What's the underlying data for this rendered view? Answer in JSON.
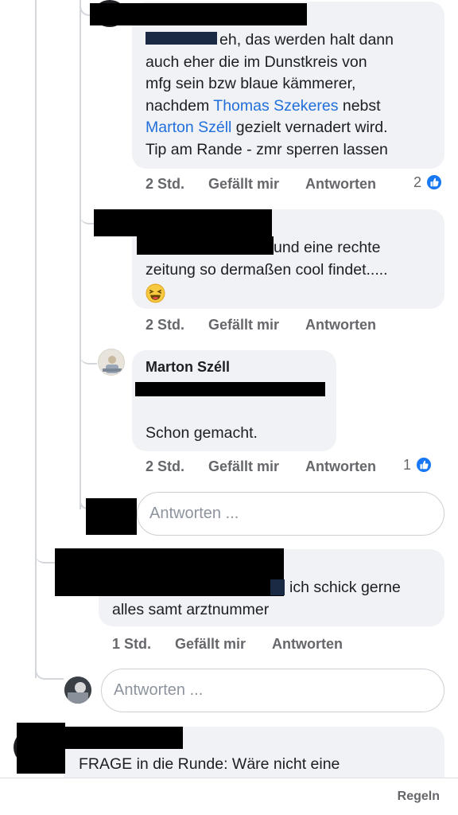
{
  "comments": [
    {
      "lines": [
        {
          "parts": [
            {
              "text": "eh, das werden halt dann",
              "link": false
            }
          ]
        },
        {
          "parts": [
            {
              "text": "auch eher die im Dunstkreis von",
              "link": false
            }
          ]
        },
        {
          "parts": [
            {
              "text": "mfg sein bzw blaue kämmerer,",
              "link": false
            }
          ]
        },
        {
          "parts": [
            {
              "text": "nachdem ",
              "link": false
            },
            {
              "text": "Thomas Szekeres",
              "link": true
            },
            {
              "text": " nebst",
              "link": false
            }
          ]
        },
        {
          "parts": [
            {
              "text": "Marton Széll",
              "link": true
            },
            {
              "text": " gezielt vernadert wird.",
              "link": false
            }
          ]
        },
        {
          "parts": [
            {
              "text": "Tip am Rande - zmr sperren lassen",
              "link": false
            }
          ]
        }
      ],
      "time": "2 Std.",
      "like_label": "Gefällt mir",
      "reply_label": "Antworten",
      "reaction_count": "2"
    },
    {
      "lines": [
        {
          "parts": [
            {
              "text": "und eine rechte",
              "link": false
            }
          ]
        },
        {
          "parts": [
            {
              "text": "zeitung so dermaßen cool findet.....",
              "link": false
            }
          ]
        }
      ],
      "emoji": "laughing-emoji",
      "time": "2 Std.",
      "like_label": "Gefällt mir",
      "reply_label": "Antworten"
    },
    {
      "author": "Marton Széll",
      "text": "Schon gemacht.",
      "time": "2 Std.",
      "like_label": "Gefällt mir",
      "reply_label": "Antworten",
      "reaction_count": "1"
    },
    {
      "lines": [
        {
          "parts": [
            {
              "text": "ich schick gerne",
              "link": false
            }
          ]
        },
        {
          "parts": [
            {
              "text": "alles samt arztnummer",
              "link": false
            }
          ]
        }
      ],
      "time": "1 Std.",
      "like_label": "Gefällt mir",
      "reply_label": "Antworten"
    },
    {
      "text": "FRAGE in die Runde: Wäre nicht eine"
    }
  ],
  "reply_boxes": [
    {
      "placeholder": "Antworten ..."
    },
    {
      "placeholder": "Antworten ..."
    }
  ],
  "footer": {
    "rules_label": "Regeln"
  },
  "colors": {
    "link": "#216fdb",
    "like": "#1877f2",
    "bubble": "#f0f2f5",
    "meta": "#65676b"
  }
}
